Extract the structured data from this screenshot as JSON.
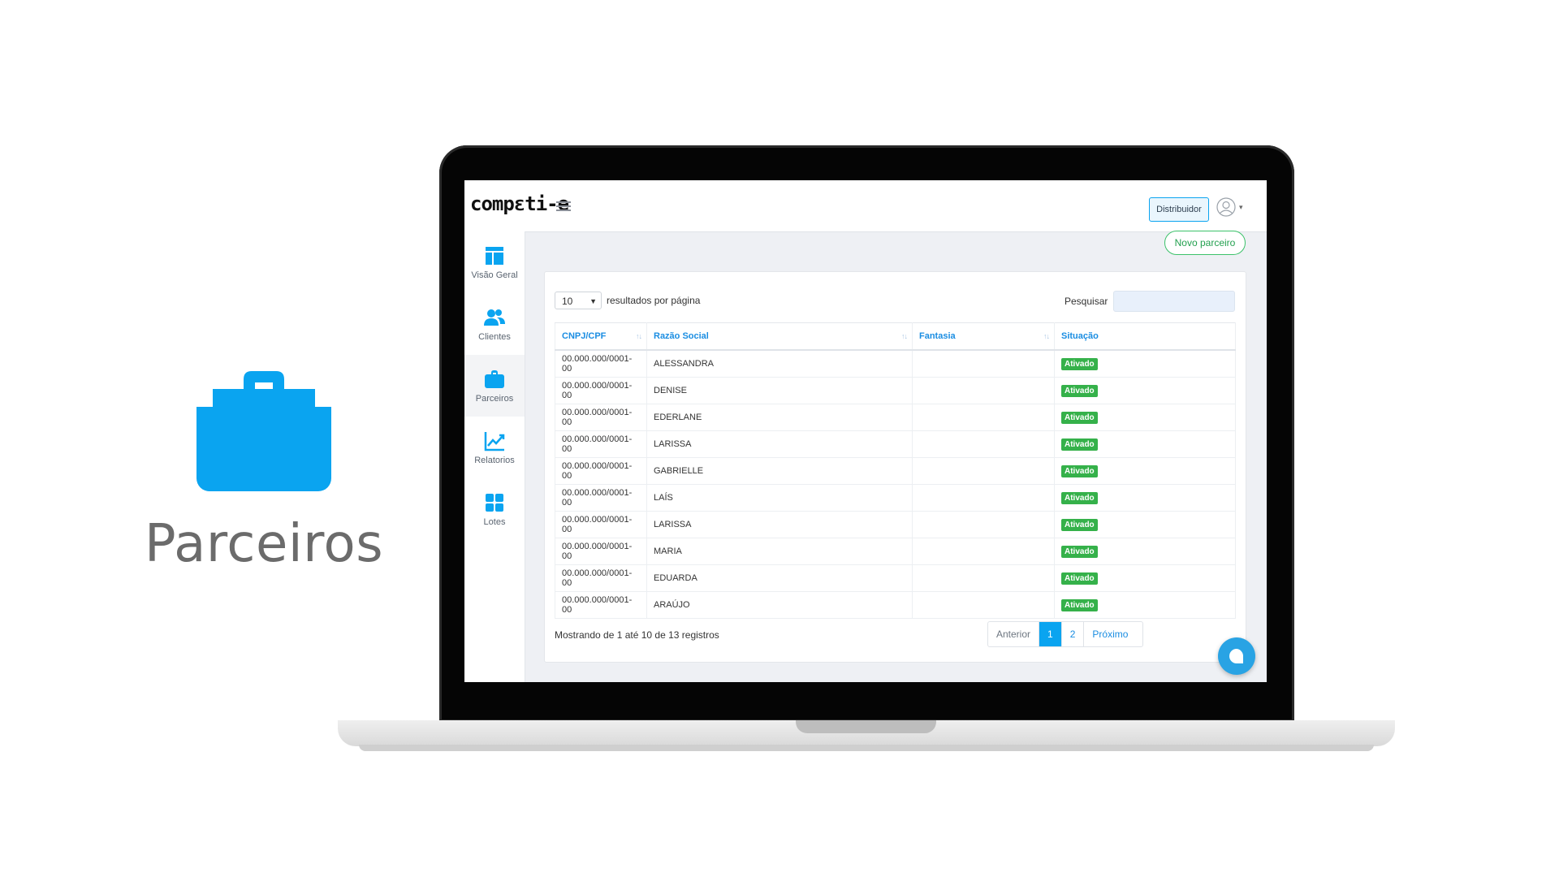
{
  "hero": {
    "icon": "briefcase-icon",
    "label": "Parceiros"
  },
  "app": {
    "logo": "compɛti-e",
    "header": {
      "distributor_label": "Distribuidor",
      "user_icon": "user-avatar-icon"
    },
    "sidebar": {
      "items": [
        {
          "label": "Visão Geral",
          "icon": "layout-icon"
        },
        {
          "label": "Clientes",
          "icon": "users-icon"
        },
        {
          "label": "Parceiros",
          "icon": "briefcase-icon",
          "active": true
        },
        {
          "label": "Relatorios",
          "icon": "chart-line-icon"
        },
        {
          "label": "Lotes",
          "icon": "grid-icon"
        }
      ]
    },
    "new_partner_label": "Novo parceiro",
    "list": {
      "page_size": "10",
      "per_page_label": "resultados por página",
      "search_label": "Pesquisar",
      "search_value": "",
      "columns": [
        "CNPJ/CPF",
        "Razão Social",
        "Fantasia",
        "Situação"
      ],
      "rows": [
        {
          "cnpj": "00.000.000/0001-00",
          "razao": "ALESSANDRA",
          "fantasia": "",
          "situacao": "Ativado"
        },
        {
          "cnpj": "00.000.000/0001-00",
          "razao": "DENISE",
          "fantasia": "",
          "situacao": "Ativado"
        },
        {
          "cnpj": "00.000.000/0001-00",
          "razao": "EDERLANE",
          "fantasia": "",
          "situacao": "Ativado"
        },
        {
          "cnpj": "00.000.000/0001-00",
          "razao": "LARISSA",
          "fantasia": "",
          "situacao": "Ativado"
        },
        {
          "cnpj": "00.000.000/0001-00",
          "razao": "GABRIELLE",
          "fantasia": "",
          "situacao": "Ativado"
        },
        {
          "cnpj": "00.000.000/0001-00",
          "razao": "LAÍS",
          "fantasia": "",
          "situacao": "Ativado"
        },
        {
          "cnpj": "00.000.000/0001-00",
          "razao": "LARISSA",
          "fantasia": "",
          "situacao": "Ativado"
        },
        {
          "cnpj": "00.000.000/0001-00",
          "razao": "MARIA",
          "fantasia": "",
          "situacao": "Ativado"
        },
        {
          "cnpj": "00.000.000/0001-00",
          "razao": "EDUARDA",
          "fantasia": "",
          "situacao": "Ativado"
        },
        {
          "cnpj": "00.000.000/0001-00",
          "razao": "ARAÚJO",
          "fantasia": "",
          "situacao": "Ativado"
        }
      ],
      "showing_text": "Mostrando de 1 até 10 de 13 registros",
      "pagination": {
        "prev": "Anterior",
        "pages": [
          "1",
          "2"
        ],
        "current": "1",
        "next": "Próximo"
      }
    },
    "chat_icon": "chat-icon",
    "colors": {
      "accent": "#0aa4f0",
      "status_green": "#35b14a",
      "new_btn_green": "#3cc26a"
    }
  }
}
